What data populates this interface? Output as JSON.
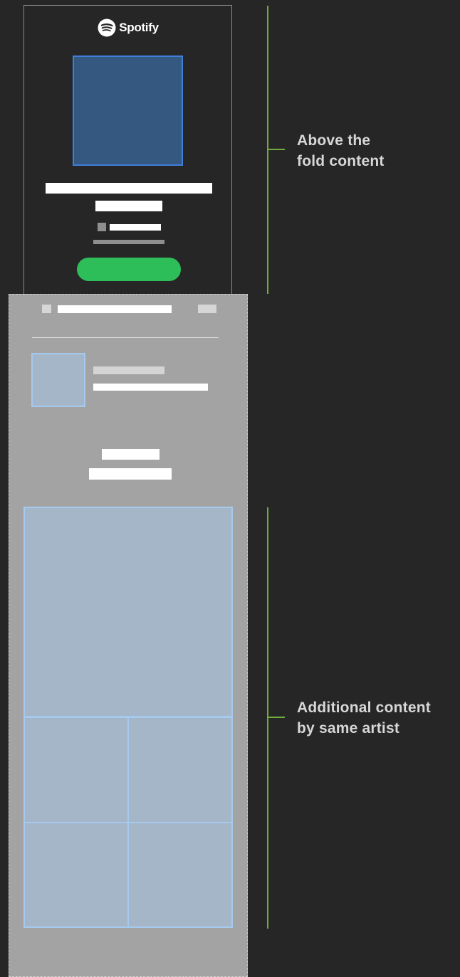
{
  "header": {
    "brand": "Spotify"
  },
  "annotations": {
    "above_fold": [
      "Above the",
      "fold content"
    ],
    "additional": [
      "Additional content",
      "by same artist"
    ]
  },
  "colors": {
    "background": "#262626",
    "panel": "#a3a3a3",
    "cover_fill": "#355880",
    "cover_border": "#3f7fd9",
    "play_button": "#2dbe5a",
    "placeholder_blue": "#a5b6c9",
    "bracket_green": "#6fae3a"
  },
  "icons": {
    "logo": "spotify-icon"
  }
}
